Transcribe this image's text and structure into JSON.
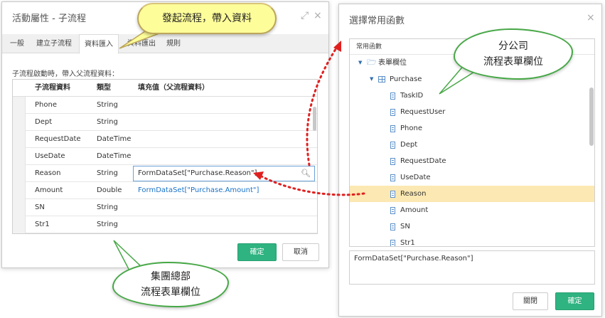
{
  "left_dialog": {
    "title": "活動屬性 - 子流程",
    "tabs": [
      {
        "label": "一般"
      },
      {
        "label": "建立子流程"
      },
      {
        "label": "資料匯入"
      },
      {
        "label": "資料匯出"
      },
      {
        "label": "規則"
      }
    ],
    "active_tab": "資料匯入",
    "section_label": "子流程啟動時，帶入父流程資料：",
    "columns": [
      "子流程資料",
      "類型",
      "填充值（父流程資料）"
    ],
    "rows": [
      {
        "name": "Phone",
        "type": "String",
        "value": ""
      },
      {
        "name": "Dept",
        "type": "String",
        "value": ""
      },
      {
        "name": "RequestDate",
        "type": "DateTime",
        "value": ""
      },
      {
        "name": "UseDate",
        "type": "DateTime",
        "value": ""
      },
      {
        "name": "Reason",
        "type": "String",
        "value": "FormDataSet[\"Purchase.Reason\"]"
      },
      {
        "name": "Amount",
        "type": "Double",
        "value": "FormDataSet[\"Purchase.Amount\"]"
      },
      {
        "name": "SN",
        "type": "String",
        "value": ""
      },
      {
        "name": "Str1",
        "type": "String",
        "value": ""
      }
    ],
    "confirm_label": "確定",
    "cancel_label": "取消"
  },
  "right_dialog": {
    "title": "選擇常用函數",
    "tree_header": "常用函數",
    "folder_label": "表單欄位",
    "table_label": "Purchase",
    "fields": [
      "TaskID",
      "RequestUser",
      "Phone",
      "Dept",
      "RequestDate",
      "UseDate",
      "Reason",
      "Amount",
      "SN",
      "Str1"
    ],
    "selected_field": "Reason",
    "result_text": "FormDataSet[\"Purchase.Reason\"]",
    "close_label": "關閉",
    "confirm_label": "確定"
  },
  "callouts": {
    "top": "發起流程，帶入資料",
    "right_line1": "分公司",
    "right_line2": "流程表單欄位",
    "bottom_line1": "集團總部",
    "bottom_line2": "流程表單欄位"
  },
  "icons": {
    "expand": "expand-icon",
    "close": "close-icon",
    "search": "search-icon",
    "folder": "folder-open-icon",
    "table": "table-icon",
    "field": "field-icon"
  },
  "colors": {
    "primary_button": "#2fb381",
    "link": "#1a73c8",
    "selection": "#fce8b2",
    "callout_border": "#46a846",
    "arrow": "#e02020"
  }
}
